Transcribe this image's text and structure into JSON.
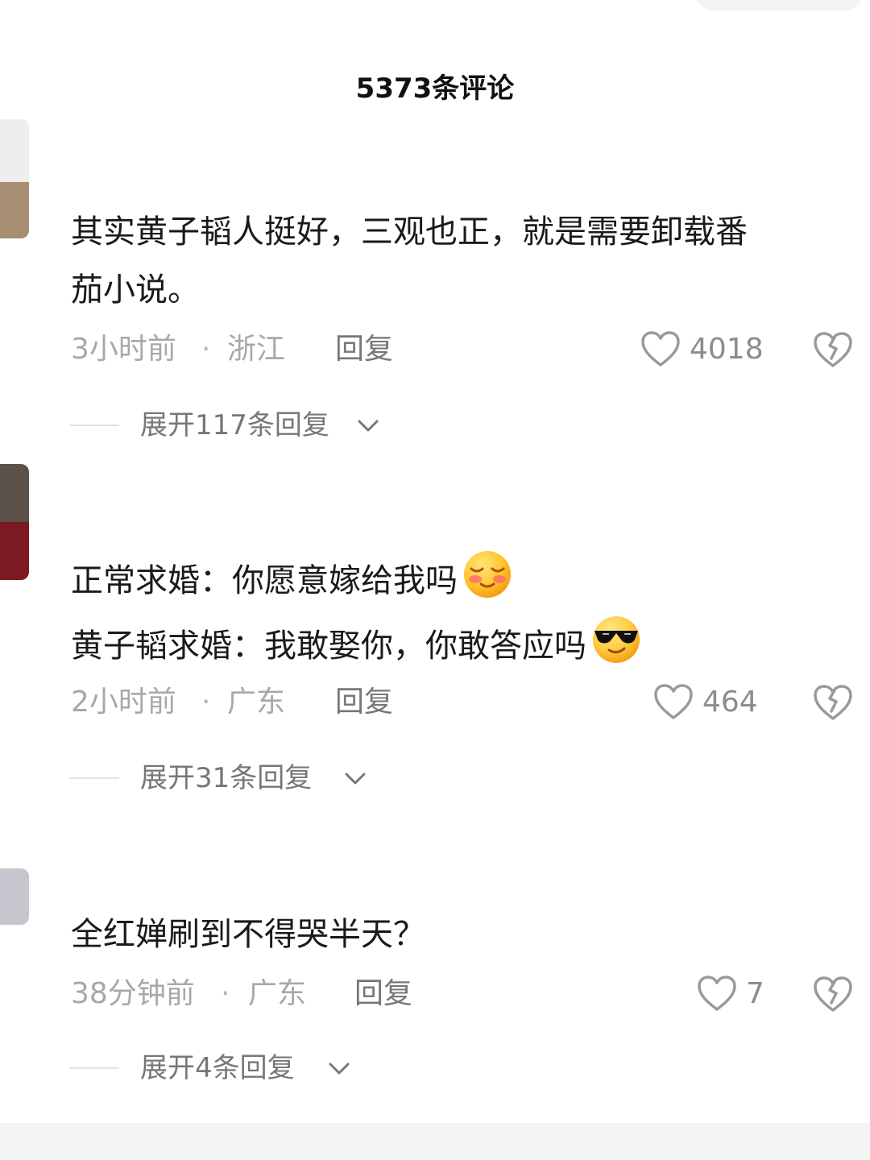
{
  "header": {
    "title": "5373条评论"
  },
  "comments": [
    {
      "text_lines": [
        "其实黄子韬人挺好，三观也正，就是需要卸载番",
        "茄小说。"
      ],
      "time": "3小时前",
      "location": "浙江",
      "reply_label": "回复",
      "like_count": "4018",
      "expand_label": "展开117条回复",
      "avatar_colors": [
        "#eeeeee",
        "#a78d72"
      ],
      "icons": [
        "heart-icon",
        "broken-heart-icon",
        "chevron-down-icon"
      ]
    },
    {
      "text_lines": [
        "正常求婚：你愿意嫁给我吗",
        "黄子韬求婚：我敢娶你，你敢答应吗"
      ],
      "time": "2小时前",
      "location": "广东",
      "reply_label": "回复",
      "like_count": "464",
      "expand_label": "展开31条回复",
      "avatar_colors": [
        "#5c5148",
        "#7b1a21"
      ],
      "emojis": [
        "blushing-smile-emoji",
        "sunglasses-smile-emoji"
      ],
      "icons": [
        "heart-icon",
        "broken-heart-icon",
        "chevron-down-icon"
      ]
    },
    {
      "text_lines": [
        "全红婵刷到不得哭半天？"
      ],
      "time": "38分钟前",
      "location": "广东",
      "reply_label": "回复",
      "like_count": "7",
      "expand_label": "展开4条回复",
      "avatar_colors": [
        "#c5c6ce"
      ],
      "icons": [
        "heart-icon",
        "broken-heart-icon",
        "chevron-down-icon"
      ]
    }
  ],
  "colors": {
    "background": "#ffffff",
    "primary_text": "#1a1a1a",
    "secondary_text": "#a8a8a8",
    "action_text": "#777777",
    "icon": "#9a9a9a"
  }
}
